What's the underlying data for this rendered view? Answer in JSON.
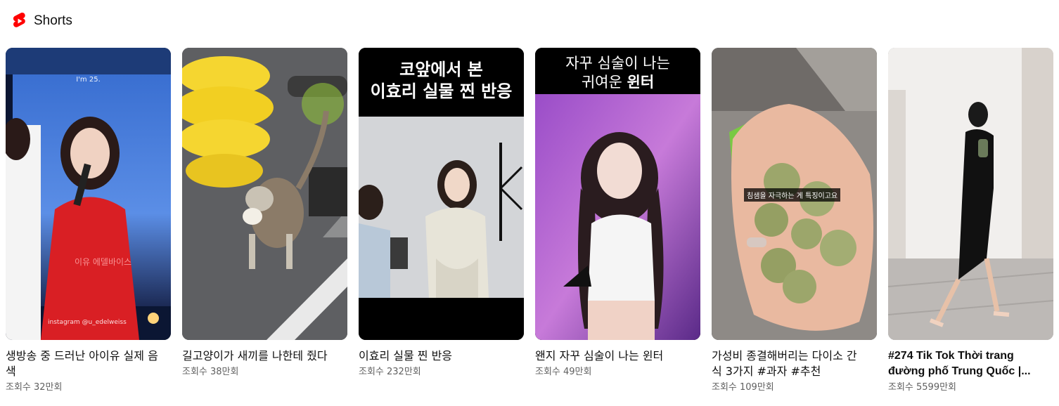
{
  "shelf": {
    "title": "Shorts",
    "logo_icon": "youtube-shorts-logo",
    "accent_color": "#ff0000"
  },
  "videos": [
    {
      "title": "생방송 중 드러난 아이유 실제 음색",
      "views": "조회수 32만회",
      "overlay_top": "I'm 25.",
      "overlay_watermark": "이유 에델바이스",
      "overlay_credit": "instagram @u_edelweiss"
    },
    {
      "title": "길고양이가 새끼를 나한테 줬다",
      "views": "조회수 38만회"
    },
    {
      "title": "이효리 실물 찐 반응",
      "views": "조회수 232만회",
      "caption_line1": "코앞에서 본",
      "caption_line2": "이효리 실물 찐 반응"
    },
    {
      "title": "왠지 자꾸 심술이 나는 윈터",
      "views": "조회수 49만회",
      "caption_line1": "자꾸 심술이 나는",
      "caption_line2_regular": "귀여운 ",
      "caption_line2_bold": "윈터"
    },
    {
      "title": "가성비 종결해버리는 다이소 간식 3가지 #과자 #추천",
      "views": "조회수 109만회",
      "subtitle": "침샘을 자극하는 게 특징이고요"
    },
    {
      "title": "#274 Tik Tok Thời trang đường phố Trung Quốc |...",
      "views": "조회수 5599만회"
    }
  ]
}
